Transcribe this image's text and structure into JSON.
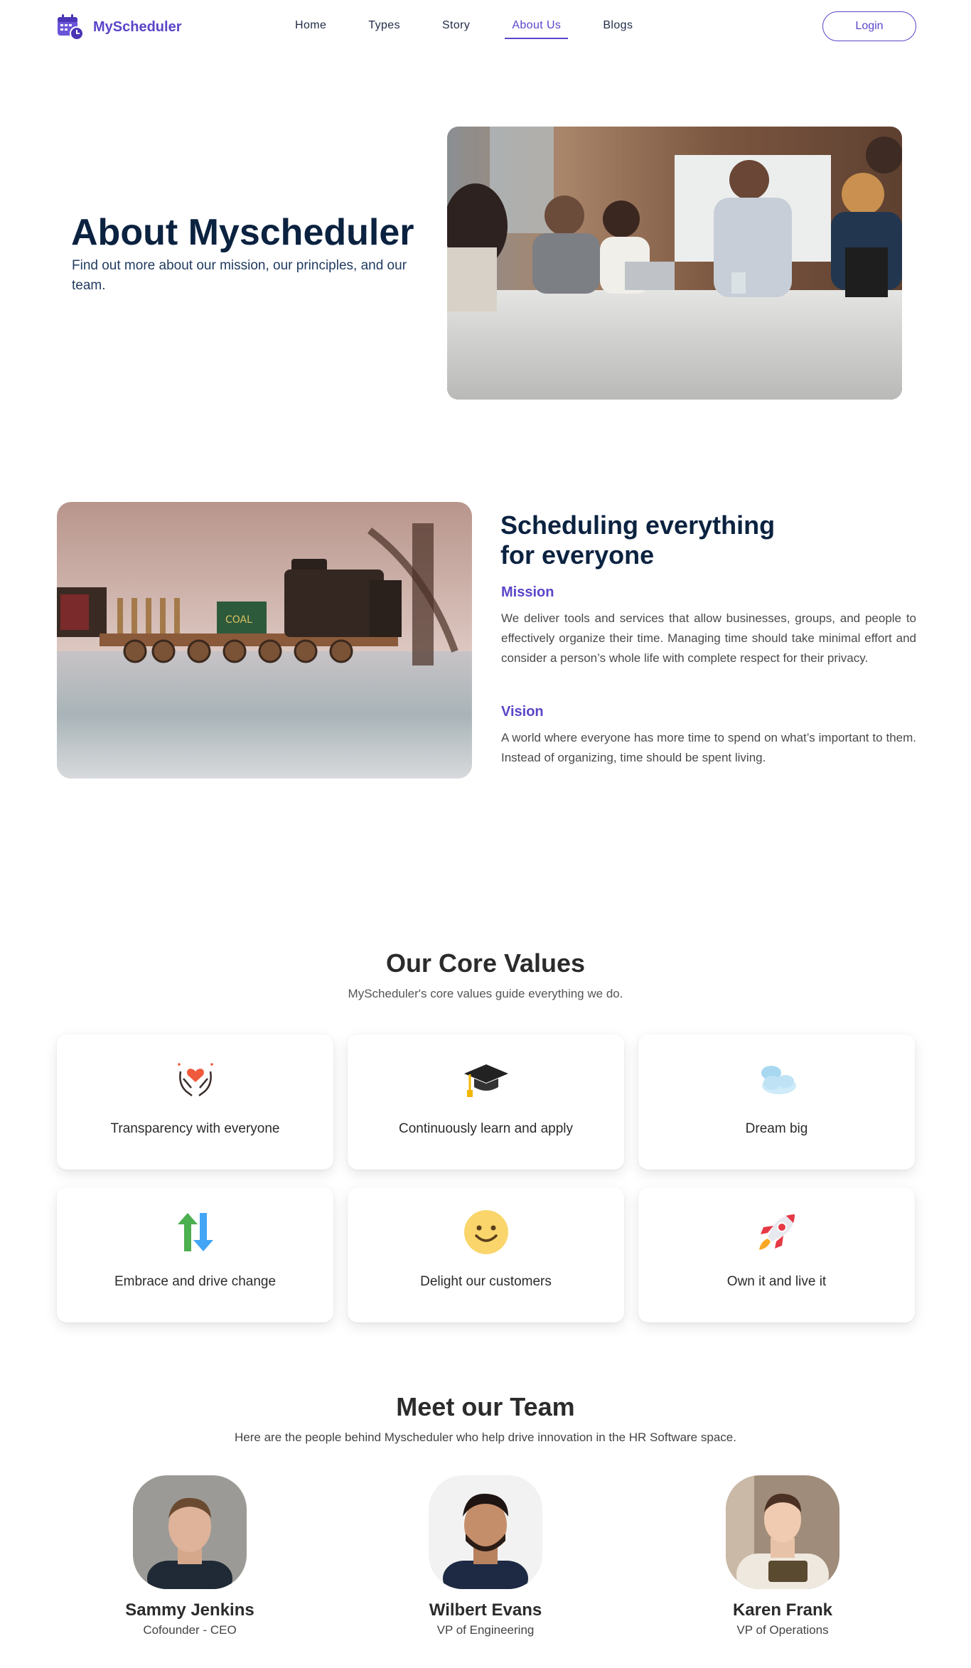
{
  "header": {
    "brand_name": "MyScheduler",
    "nav": [
      "Home",
      "Types",
      "Story",
      "About Us",
      "Blogs"
    ],
    "active_nav": "About Us",
    "login_label": "Login"
  },
  "hero": {
    "title": "About Myscheduler",
    "subtitle": "Find out more about our mission, our principles, and our team."
  },
  "mission": {
    "title_line1": "Scheduling everything",
    "title_line2": "for everyone",
    "mission_label": "Mission",
    "mission_text": "We deliver tools and services that allow businesses, groups, and people to effectively organize their time. Managing time should take minimal effort and consider a person’s whole life with complete respect for their privacy.",
    "vision_label": "Vision",
    "vision_text": "A world where everyone has more time to spend on what’s important to them. Instead of organizing, time should be spent living."
  },
  "core_values": {
    "title": "Our Core Values",
    "subtitle": "MyScheduler's core values guide everything we do.",
    "items": [
      {
        "label": "Transparency with everyone",
        "icon": "hands-heart-icon"
      },
      {
        "label": "Continuously learn and apply",
        "icon": "graduation-cap-icon"
      },
      {
        "label": "Dream big",
        "icon": "clouds-icon"
      },
      {
        "label": "Embrace and drive change",
        "icon": "arrows-exchange-icon"
      },
      {
        "label": "Delight our customers",
        "icon": "smiley-icon"
      },
      {
        "label": "Own it and live it",
        "icon": "rocket-icon"
      }
    ]
  },
  "team": {
    "title": "Meet our Team",
    "subtitle": "Here are the people behind Myscheduler who help drive innovation in the HR Software space.",
    "members": [
      {
        "name": "Sammy Jenkins",
        "role": "Cofounder - CEO"
      },
      {
        "name": "Wilbert Evans",
        "role": "VP of Engineering"
      },
      {
        "name": "Karen Frank",
        "role": "VP of Operations"
      }
    ]
  },
  "colors": {
    "accent": "#5b45c9",
    "heading": "#0b2240"
  }
}
